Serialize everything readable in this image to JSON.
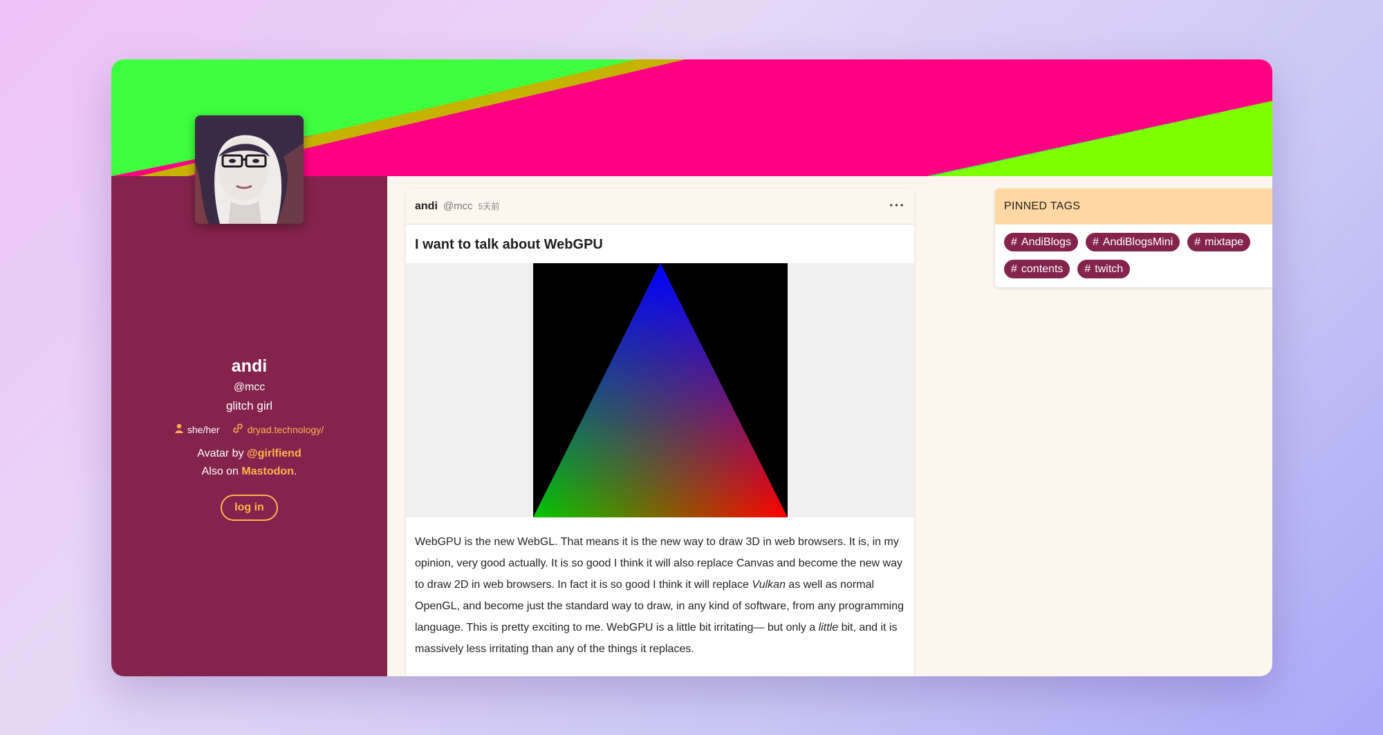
{
  "profile": {
    "name": "andi",
    "handle": "@mcc",
    "description": "glitch girl",
    "pronouns": "she/her",
    "website": "dryad.technology/",
    "avatar_credit_prefix": "Avatar by ",
    "avatar_credit_link": "@girlfiend",
    "also_on_prefix": "Also on ",
    "also_on_link": "Mastodon",
    "also_on_suffix": ".",
    "login_label": "log in"
  },
  "post": {
    "author": "andi",
    "handle": "@mcc",
    "time": "5天前",
    "more_label": "···",
    "title": "I want to talk about WebGPU",
    "body_1": "WebGPU is the new WebGL. That means it is the new way to draw 3D in web browsers. It is, in my opinion, very good actually. It is so good I think it will also replace Canvas and become the new way to draw 2D in web browsers. In fact it is so good I think it will replace ",
    "body_em_1": "Vulkan",
    "body_2": " as well as normal OpenGL, and become just the standard way to draw, in any kind of software, from any programming language. This is pretty exciting to me. WebGPU is a little bit irritating— but only a ",
    "body_em_2": "little",
    "body_3": " bit, and it is massively less irritating than any of the things it replaces."
  },
  "pinned": {
    "title": "PINNED TAGS",
    "tags": [
      "AndiBlogs",
      "AndiBlogsMini",
      "mixtape",
      "contents",
      "twitch"
    ]
  },
  "colors": {
    "sidebar": "#84234d",
    "accent": "#ffb54b",
    "banner_green": "#3dff3f",
    "banner_pink": "#ff0083",
    "banner_lime": "#80ff00",
    "pinned_header": "#ffd7a3"
  }
}
